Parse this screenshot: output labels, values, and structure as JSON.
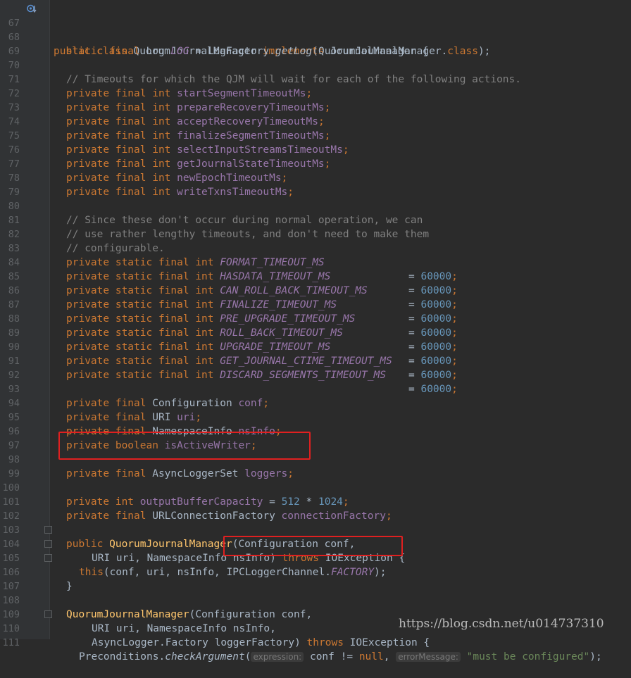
{
  "lines": [
    {
      "n": "67"
    },
    {
      "n": "68"
    },
    {
      "n": "69"
    },
    {
      "n": "70"
    },
    {
      "n": "71"
    },
    {
      "n": "72"
    },
    {
      "n": "73"
    },
    {
      "n": "74"
    },
    {
      "n": "75"
    },
    {
      "n": "76"
    },
    {
      "n": "77"
    },
    {
      "n": "78"
    },
    {
      "n": "79"
    },
    {
      "n": "80"
    },
    {
      "n": "81"
    },
    {
      "n": "82"
    },
    {
      "n": "83"
    },
    {
      "n": "84"
    },
    {
      "n": "85"
    },
    {
      "n": "86"
    },
    {
      "n": "87"
    },
    {
      "n": "88"
    },
    {
      "n": "89"
    },
    {
      "n": "90"
    },
    {
      "n": "91"
    },
    {
      "n": "92"
    },
    {
      "n": "93"
    },
    {
      "n": "94"
    },
    {
      "n": "95"
    },
    {
      "n": "96"
    },
    {
      "n": "97"
    },
    {
      "n": "98"
    },
    {
      "n": "99"
    },
    {
      "n": "100"
    },
    {
      "n": "101"
    },
    {
      "n": "102"
    },
    {
      "n": "103"
    },
    {
      "n": "104"
    },
    {
      "n": "105"
    },
    {
      "n": "106"
    },
    {
      "n": "107"
    },
    {
      "n": "108"
    },
    {
      "n": "109"
    },
    {
      "n": "110"
    },
    {
      "n": "111"
    }
  ],
  "code": {
    "class_decl": {
      "kw": "public class ",
      "name": "QuorumJournalManager ",
      "impl": "implements ",
      "iface": "JournalManager {"
    },
    "log_line": {
      "kw": "static final ",
      "type": "Log ",
      "field": "LOG",
      "eq": " = LogFactory.",
      "method": "getLog",
      "rest": "(QuorumJournalManager.",
      "cls": "class",
      "end": ");"
    },
    "comment_timeouts": "// Timeouts for which the QJM will wait for each of the following actions.",
    "timeout_fields": [
      "startSegmentTimeoutMs",
      "prepareRecoveryTimeoutMs",
      "acceptRecoveryTimeoutMs",
      "finalizeSegmentTimeoutMs",
      "selectInputStreamsTimeoutMs",
      "getJournalStateTimeoutMs",
      "newEpochTimeoutMs",
      "writeTxnsTimeoutMs"
    ],
    "pf_int": "private final int ",
    "comment_since": [
      "// Since these don't occur during normal operation, we can",
      "// use rather lengthy timeouts, and don't need to make them",
      "// configurable."
    ],
    "psf_int": "private static final int ",
    "constants": [
      "FORMAT_TIMEOUT_MS",
      "HASDATA_TIMEOUT_MS",
      "CAN_ROLL_BACK_TIMEOUT_MS",
      "FINALIZE_TIMEOUT_MS",
      "PRE_UPGRADE_TIMEOUT_MS",
      "ROLL_BACK_TIMEOUT_MS",
      "UPGRADE_TIMEOUT_MS",
      "GET_JOURNAL_CTIME_TIMEOUT_MS",
      "DISCARD_SEGMENTS_TIMEOUT_MS"
    ],
    "const_value": "60000",
    "semi": ";",
    "eq": "= ",
    "fields": [
      {
        "mods": "private final ",
        "type": "Configuration ",
        "name": "conf"
      },
      {
        "mods": "private final ",
        "type": "URI ",
        "name": "uri"
      },
      {
        "mods": "private final ",
        "type": "NamespaceInfo ",
        "name": "nsInfo"
      },
      {
        "mods": "private boolean ",
        "type": "",
        "name": "isActiveWriter"
      }
    ],
    "loggers": {
      "mods": "private final ",
      "type": "AsyncLoggerSet ",
      "name": "loggers"
    },
    "buffer": {
      "mods": "private int ",
      "name": "outputBufferCapacity",
      "eq": " = ",
      "a": "512",
      "op": " * ",
      "b": "1024",
      "end": ";"
    },
    "conn": {
      "mods": "private final ",
      "type": "URLConnectionFactory ",
      "name": "connectionFactory",
      "end": ";"
    },
    "ctor1": {
      "kw": "public ",
      "name": "QuorumJournalManager",
      "args": "(Configuration conf,"
    },
    "ctor1_l2": {
      "args": "URI uri, NamespaceInfo nsInfo) ",
      "throws": "throws ",
      "exc": "IOException {"
    },
    "ctor1_l3": {
      "kw": "this",
      "args": "(conf, uri, nsInfo, ",
      "chan": "IPCLoggerChannel.",
      "fac": "FACTORY",
      "end": ");"
    },
    "close_brace": "}",
    "ctor2": {
      "name": "QuorumJournalManager",
      "args": "(Configuration conf,"
    },
    "ctor2_l2": "URI uri, NamespaceInfo nsInfo,",
    "ctor2_l3": {
      "args": "AsyncLogger.Factory loggerFactory) ",
      "throws": "throws ",
      "exc": "IOException {"
    },
    "ctor2_l4": {
      "cls": "Preconditions.",
      "method": "checkArgument",
      "open": "(",
      "hint1": "expression:",
      "cond": " conf != ",
      "nul": "null",
      "comma": ", ",
      "hint2": "errorMessage:",
      "str": " \"must be configured\"",
      "end": ");"
    }
  },
  "watermark": "https://blog.csdn.net/u014737310",
  "colors": {
    "keyword": "#cc7832",
    "field": "#9876aa",
    "number": "#6897bb",
    "comment": "#808080",
    "method": "#ffc66d",
    "highlight_box": "#e02020"
  }
}
